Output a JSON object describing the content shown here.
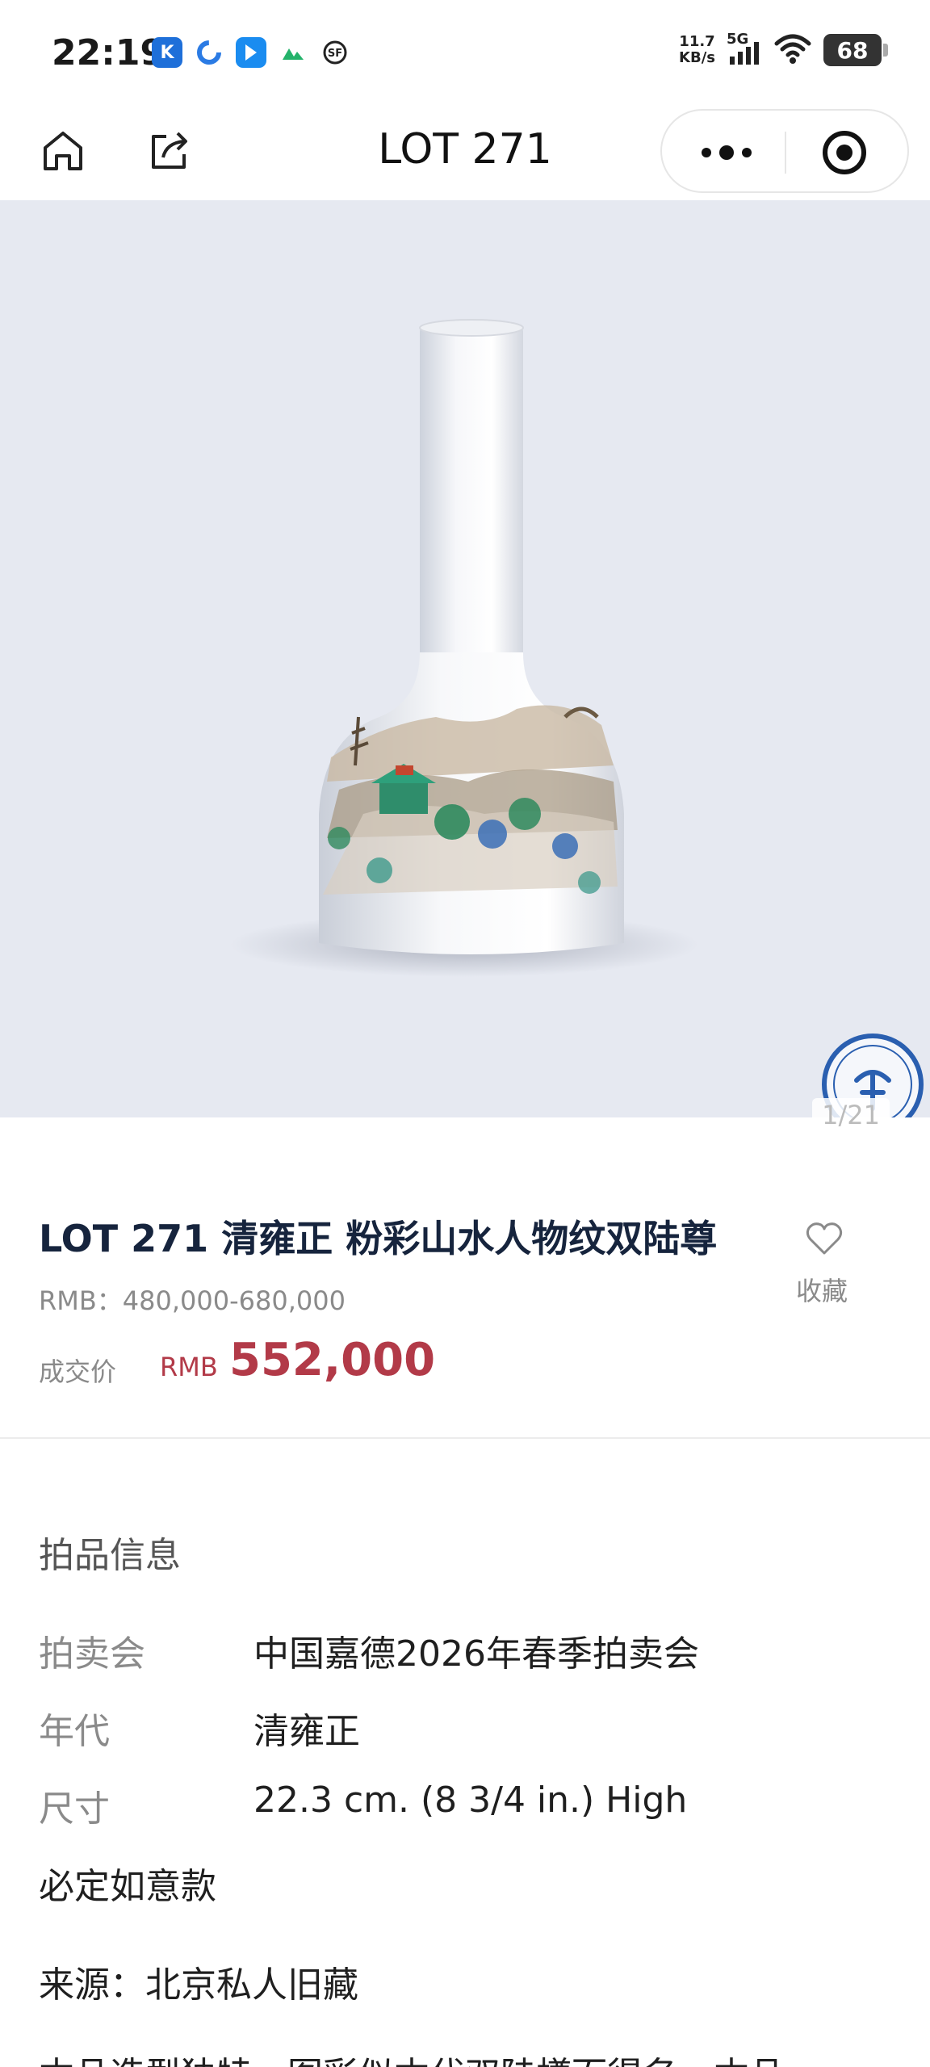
{
  "status_bar": {
    "time": "22:19",
    "app_icons": [
      "k-app-icon",
      "browser-icon",
      "arrow-app-icon",
      "leaf-app-icon",
      "sf-app-icon"
    ],
    "net_speed_value": "11.7",
    "net_speed_unit": "KB/s",
    "network": "5G",
    "battery": "68"
  },
  "nav": {
    "title": "LOT 271"
  },
  "hero": {
    "counter": "1/21"
  },
  "lot": {
    "title": "LOT 271 清雍正 粉彩山水人物纹双陆尊",
    "estimate": "RMB：480,000-680,000",
    "deal_label": "成交价",
    "deal_currency": "RMB",
    "deal_price": "552,000",
    "favorite_label": "收藏"
  },
  "info": {
    "section_title": "拍品信息",
    "rows": [
      {
        "key": "拍卖会",
        "value": "中国嘉德2026年春季拍卖会"
      },
      {
        "key": "年代",
        "value": "清雍正"
      },
      {
        "key": "尺寸",
        "value": "22.3 cm. (8 3/4 in.) High"
      }
    ],
    "mark": "必定如意款",
    "provenance": "来源：北京私人旧藏",
    "description_partial": "本品造型独特，图彩似本代双陆樽而得名，本品"
  },
  "colors": {
    "accent_price": "#b23a48",
    "title_navy": "#16243d",
    "hero_bg": "#e6e9f1"
  }
}
